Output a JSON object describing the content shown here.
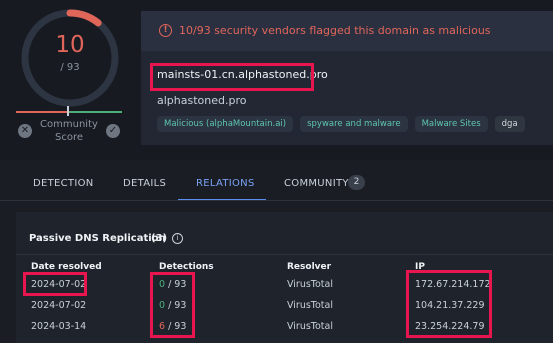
{
  "score": {
    "detections": "10",
    "total": "/ 93",
    "community_label_line1": "Community",
    "community_label_line2": "Score",
    "community_score_fraction": 0.5,
    "malicious_fraction": 0.1075
  },
  "alert": {
    "icon": "exclamation-circle-icon",
    "text": "10/93 security vendors flagged this domain as malicious"
  },
  "domain": {
    "name": "mainsts-01.cn.alphastoned.pro",
    "parent": "alphastoned.pro",
    "tags": [
      "Malicious (alphaMountain.ai)",
      "spyware and malware",
      "Malware Sites",
      "dga"
    ]
  },
  "tabs": {
    "detection": "DETECTION",
    "details": "DETAILS",
    "relations": "RELATIONS",
    "community": "COMMUNITY",
    "community_count": "2"
  },
  "passive_dns": {
    "title": "Passive DNS Replication",
    "count": "(3)",
    "headers": {
      "date": "Date resolved",
      "detections": "Detections",
      "resolver": "Resolver",
      "ip": "IP"
    },
    "rows": [
      {
        "date": "2024-07-02",
        "det": "0",
        "det_total": "/ 93",
        "resolver": "VirusTotal",
        "ip": "172.67.214.172"
      },
      {
        "date": "2024-07-02",
        "det": "0",
        "det_total": "/ 93",
        "resolver": "VirusTotal",
        "ip": "104.21.37.229"
      },
      {
        "date": "2024-03-14",
        "det": "6",
        "det_total": "/ 93",
        "resolver": "VirusTotal",
        "ip": "23.254.224.79"
      }
    ]
  },
  "colors": {
    "malicious": "#e0665a",
    "clean": "#4caf7a",
    "accent": "#5b8ef0",
    "highlight": "#e8154f"
  }
}
